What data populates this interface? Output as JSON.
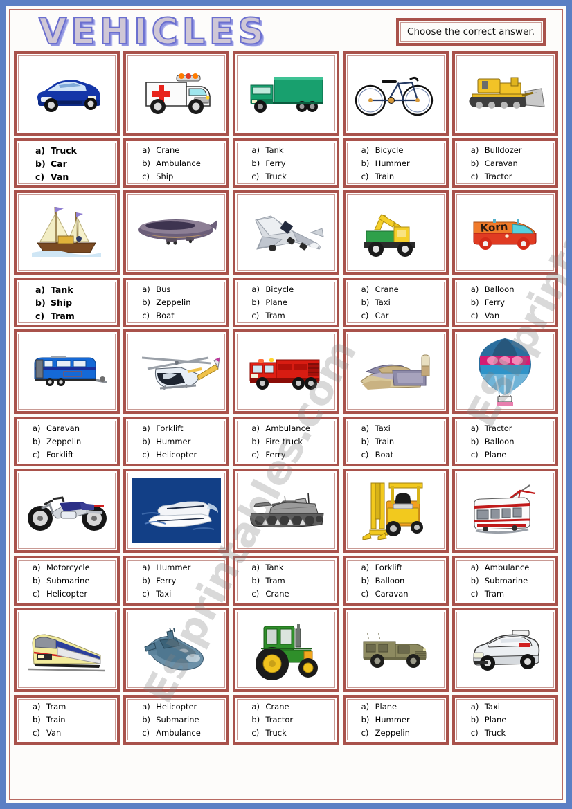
{
  "worksheet": {
    "title": "VEHICLES",
    "instruction": "Choose the correct answer.",
    "watermark_1": "ESLprintables.com",
    "watermark_2": "Eslprintables.com",
    "accent_color": "#a9524b",
    "title_color": "#8f93e0",
    "page_background": "#5b7fc4"
  },
  "items": [
    {
      "id": 1,
      "image_name": "car-image",
      "image_caption": "blue car",
      "bold": true,
      "options": [
        {
          "letter": "a)",
          "label": "Truck"
        },
        {
          "letter": "b)",
          "label": "Car"
        },
        {
          "letter": "c)",
          "label": "Van"
        }
      ]
    },
    {
      "id": 2,
      "image_name": "ambulance-image",
      "image_caption": "white ambulance",
      "bold": false,
      "options": [
        {
          "letter": "a)",
          "label": "Crane"
        },
        {
          "letter": "b)",
          "label": "Ambulance"
        },
        {
          "letter": "c)",
          "label": "Ship"
        }
      ]
    },
    {
      "id": 3,
      "image_name": "truck-image",
      "image_caption": "green truck",
      "bold": false,
      "options": [
        {
          "letter": "a)",
          "label": "Tank"
        },
        {
          "letter": "b)",
          "label": "Ferry"
        },
        {
          "letter": "c)",
          "label": "Truck"
        }
      ]
    },
    {
      "id": 4,
      "image_name": "bicycle-image",
      "image_caption": "bicycle",
      "bold": false,
      "options": [
        {
          "letter": "a)",
          "label": "Bicycle"
        },
        {
          "letter": "b)",
          "label": "Hummer"
        },
        {
          "letter": "c)",
          "label": "Train"
        }
      ]
    },
    {
      "id": 5,
      "image_name": "bulldozer-image",
      "image_caption": "yellow bulldozer",
      "bold": false,
      "options": [
        {
          "letter": "a)",
          "label": "Bulldozer"
        },
        {
          "letter": "b)",
          "label": "Caravan"
        },
        {
          "letter": "c)",
          "label": "Tractor"
        }
      ]
    },
    {
      "id": 6,
      "image_name": "ship-image",
      "image_caption": "sailing ship",
      "bold": true,
      "options": [
        {
          "letter": "a)",
          "label": "Tank"
        },
        {
          "letter": "b)",
          "label": "Ship"
        },
        {
          "letter": "c)",
          "label": "Tram"
        }
      ]
    },
    {
      "id": 7,
      "image_name": "zeppelin-image",
      "image_caption": "zeppelin airship",
      "bold": false,
      "options": [
        {
          "letter": "a)",
          "label": "Bus"
        },
        {
          "letter": "b)",
          "label": "Zeppelin"
        },
        {
          "letter": "c)",
          "label": "Boat"
        }
      ]
    },
    {
      "id": 8,
      "image_name": "plane-image",
      "image_caption": "passenger plane",
      "bold": false,
      "options": [
        {
          "letter": "a)",
          "label": "Bicycle"
        },
        {
          "letter": "b)",
          "label": "Plane"
        },
        {
          "letter": "c)",
          "label": "Tram"
        }
      ]
    },
    {
      "id": 9,
      "image_name": "crane-image",
      "image_caption": "crane truck toy",
      "bold": false,
      "options": [
        {
          "letter": "a)",
          "label": "Crane"
        },
        {
          "letter": "b)",
          "label": "Taxi"
        },
        {
          "letter": "c)",
          "label": "Car"
        }
      ]
    },
    {
      "id": 10,
      "image_name": "van-image",
      "image_caption": "orange van",
      "bold": false,
      "options": [
        {
          "letter": "a)",
          "label": "Balloon"
        },
        {
          "letter": "b)",
          "label": "Ferry"
        },
        {
          "letter": "c)",
          "label": "Van"
        }
      ]
    },
    {
      "id": 11,
      "image_name": "caravan-image",
      "image_caption": "blue caravan",
      "bold": false,
      "options": [
        {
          "letter": "a)",
          "label": "Caravan"
        },
        {
          "letter": "b)",
          "label": "Zeppelin"
        },
        {
          "letter": "c)",
          "label": "Forklift"
        }
      ]
    },
    {
      "id": 12,
      "image_name": "helicopter-image",
      "image_caption": "helicopter",
      "bold": false,
      "options": [
        {
          "letter": "a)",
          "label": "Forklift"
        },
        {
          "letter": "b)",
          "label": "Hummer"
        },
        {
          "letter": "c)",
          "label": "Helicopter"
        }
      ]
    },
    {
      "id": 13,
      "image_name": "fire-truck-image",
      "image_caption": "red fire truck",
      "bold": false,
      "options": [
        {
          "letter": "a)",
          "label": "Ambulance"
        },
        {
          "letter": "b)",
          "label": "Fire truck"
        },
        {
          "letter": "c)",
          "label": "Ferry"
        }
      ]
    },
    {
      "id": 14,
      "image_name": "boat-image",
      "image_caption": "wooden rowing boat",
      "bold": false,
      "options": [
        {
          "letter": "a)",
          "label": "Taxi"
        },
        {
          "letter": "b)",
          "label": "Train"
        },
        {
          "letter": "c)",
          "label": "Boat"
        }
      ]
    },
    {
      "id": 15,
      "image_name": "balloon-image",
      "image_caption": "hot air balloon",
      "bold": false,
      "options": [
        {
          "letter": "a)",
          "label": "Tractor"
        },
        {
          "letter": "b)",
          "label": "Balloon"
        },
        {
          "letter": "c)",
          "label": "Plane"
        }
      ]
    },
    {
      "id": 16,
      "image_name": "motorcycle-image",
      "image_caption": "motorcycle",
      "bold": false,
      "options": [
        {
          "letter": "a)",
          "label": "Motorcycle"
        },
        {
          "letter": "b)",
          "label": "Submarine"
        },
        {
          "letter": "c)",
          "label": "Helicopter"
        }
      ]
    },
    {
      "id": 17,
      "image_name": "ferry-image",
      "image_caption": "fast ferry at sea",
      "bold": false,
      "options": [
        {
          "letter": "a)",
          "label": "Hummer"
        },
        {
          "letter": "b)",
          "label": "Ferry"
        },
        {
          "letter": "c)",
          "label": "Taxi"
        }
      ]
    },
    {
      "id": 18,
      "image_name": "tank-image",
      "image_caption": "army tank",
      "bold": false,
      "options": [
        {
          "letter": "a)",
          "label": "Tank"
        },
        {
          "letter": "b)",
          "label": "Tram"
        },
        {
          "letter": "c)",
          "label": "Crane"
        }
      ]
    },
    {
      "id": 19,
      "image_name": "forklift-image",
      "image_caption": "yellow forklift",
      "bold": false,
      "options": [
        {
          "letter": "a)",
          "label": "Forklift"
        },
        {
          "letter": "b)",
          "label": "Balloon"
        },
        {
          "letter": "c)",
          "label": "Caravan"
        }
      ]
    },
    {
      "id": 20,
      "image_name": "tram-image",
      "image_caption": "red and white tram",
      "bold": false,
      "options": [
        {
          "letter": "a)",
          "label": "Ambulance"
        },
        {
          "letter": "b)",
          "label": "Submarine"
        },
        {
          "letter": "c)",
          "label": "Tram"
        }
      ]
    },
    {
      "id": 21,
      "image_name": "train-image",
      "image_caption": "passenger train",
      "bold": false,
      "options": [
        {
          "letter": "a)",
          "label": "Tram"
        },
        {
          "letter": "b)",
          "label": "Train"
        },
        {
          "letter": "c)",
          "label": "Van"
        }
      ]
    },
    {
      "id": 22,
      "image_name": "submarine-image",
      "image_caption": "submarine",
      "bold": false,
      "options": [
        {
          "letter": "a)",
          "label": "Helicopter"
        },
        {
          "letter": "b)",
          "label": "Submarine"
        },
        {
          "letter": "c)",
          "label": "Ambulance"
        }
      ]
    },
    {
      "id": 23,
      "image_name": "tractor-image",
      "image_caption": "green tractor",
      "bold": false,
      "options": [
        {
          "letter": "a)",
          "label": "Crane"
        },
        {
          "letter": "b)",
          "label": "Tractor"
        },
        {
          "letter": "c)",
          "label": "Truck"
        }
      ]
    },
    {
      "id": 24,
      "image_name": "hummer-image",
      "image_caption": "military hummer",
      "bold": false,
      "options": [
        {
          "letter": "a)",
          "label": "Plane"
        },
        {
          "letter": "b)",
          "label": "Hummer"
        },
        {
          "letter": "c)",
          "label": "Zeppelin"
        }
      ]
    },
    {
      "id": 25,
      "image_name": "taxi-image",
      "image_caption": "white taxi car",
      "bold": false,
      "options": [
        {
          "letter": "a)",
          "label": "Taxi"
        },
        {
          "letter": "b)",
          "label": "Plane"
        },
        {
          "letter": "c)",
          "label": "Truck"
        }
      ]
    }
  ]
}
